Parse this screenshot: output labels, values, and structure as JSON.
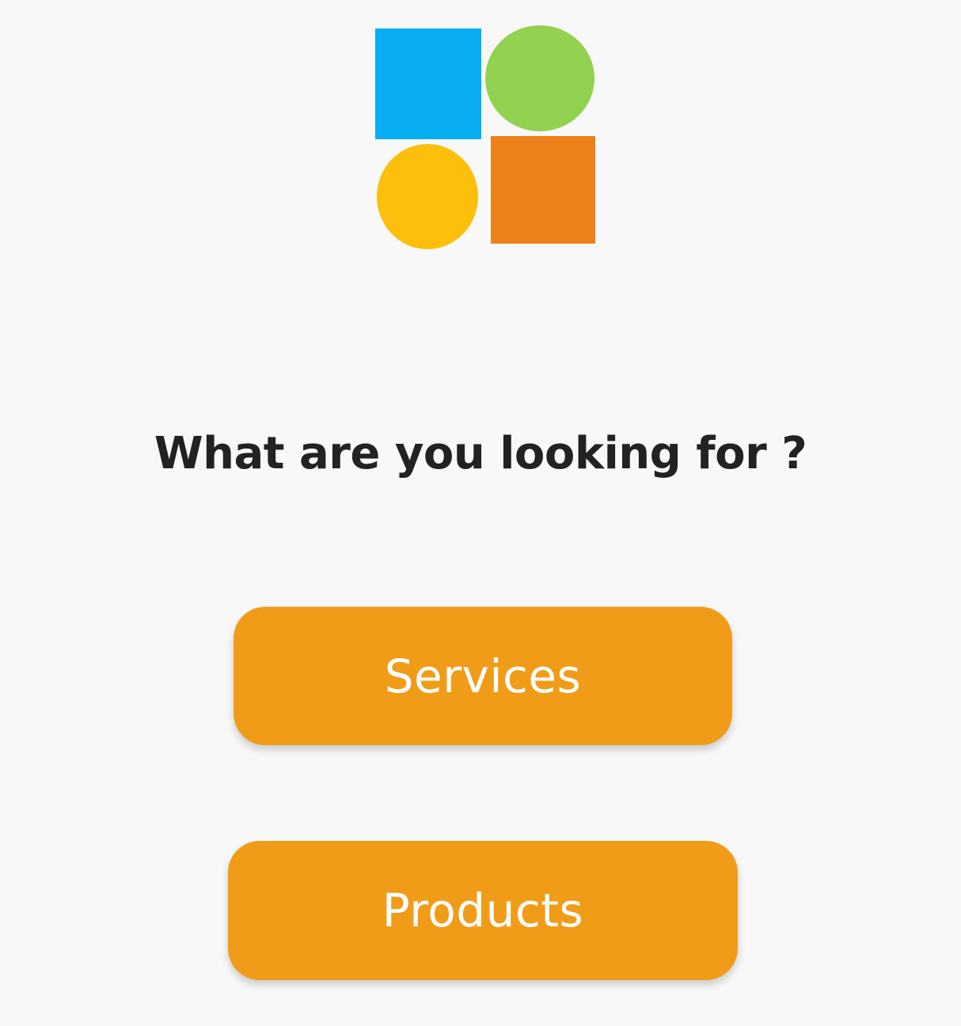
{
  "colors": {
    "background": "#f8f8f8",
    "logo_blue": "#08aef0",
    "logo_green": "#93d150",
    "logo_yellow": "#fcbf0b",
    "logo_orange": "#ed8119",
    "button_background": "#f19c18",
    "button_text": "#ffffff",
    "question_text": "#222222"
  },
  "logo": {
    "shapes": [
      "blue-square",
      "green-circle",
      "yellow-circle",
      "orange-square"
    ]
  },
  "main": {
    "question": "What are you looking for ?",
    "buttons": [
      {
        "label": "Services"
      },
      {
        "label": "Products"
      }
    ]
  }
}
